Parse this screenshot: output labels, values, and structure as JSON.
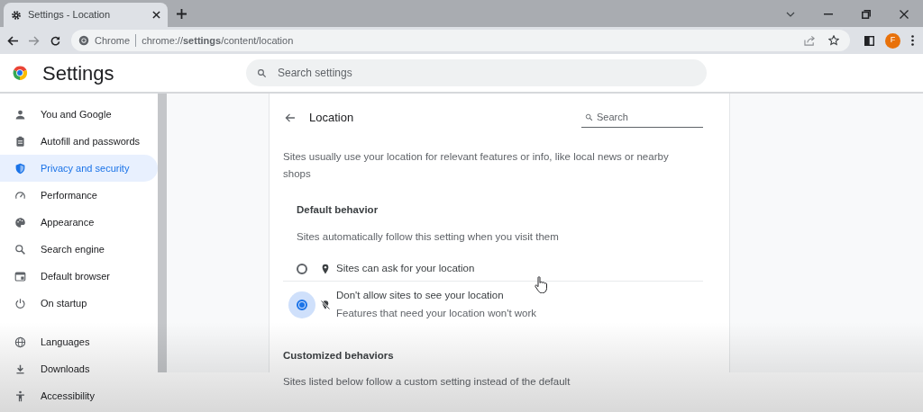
{
  "tab": {
    "title": "Settings - Location",
    "selected": true
  },
  "address_bar": {
    "site_label": "Chrome",
    "url": "chrome://**settings**/content/location"
  },
  "profile": {
    "initial": "F"
  },
  "header": {
    "title": "Settings",
    "search": {
      "placeholder": "Search settings"
    }
  },
  "sidebar": {
    "groups": [
      {
        "items": [
          {
            "label": "You and Google",
            "selected": false
          },
          {
            "label": "Autofill and passwords",
            "selected": false
          },
          {
            "label": "Privacy and security",
            "selected": true
          },
          {
            "label": "Performance",
            "selected": false
          },
          {
            "label": "Appearance",
            "selected": false
          },
          {
            "label": "Search engine",
            "selected": false
          },
          {
            "label": "Default browser",
            "selected": false
          },
          {
            "label": "On startup",
            "selected": false
          }
        ]
      },
      {
        "items": [
          {
            "label": "Languages",
            "selected": false
          },
          {
            "label": "Downloads",
            "selected": false
          },
          {
            "label": "Accessibility",
            "selected": false
          }
        ]
      }
    ]
  },
  "page": {
    "title": "Location",
    "search": {
      "placeholder": "Search"
    },
    "description": "Sites usually use your location for relevant features or info, like local news or nearby shops",
    "default_behavior": {
      "title": "Default behavior",
      "subtitle": "Sites automatically follow this setting when you visit them",
      "options": [
        {
          "label": "Sites can ask for your location",
          "selected": false
        },
        {
          "label": "Don't allow sites to see your location",
          "sublabel": "Features that need your location won't work",
          "selected": true
        }
      ]
    },
    "customized_behaviors": {
      "title": "Customized behaviors",
      "subtitle": "Sites listed below follow a custom setting instead of the default"
    }
  }
}
